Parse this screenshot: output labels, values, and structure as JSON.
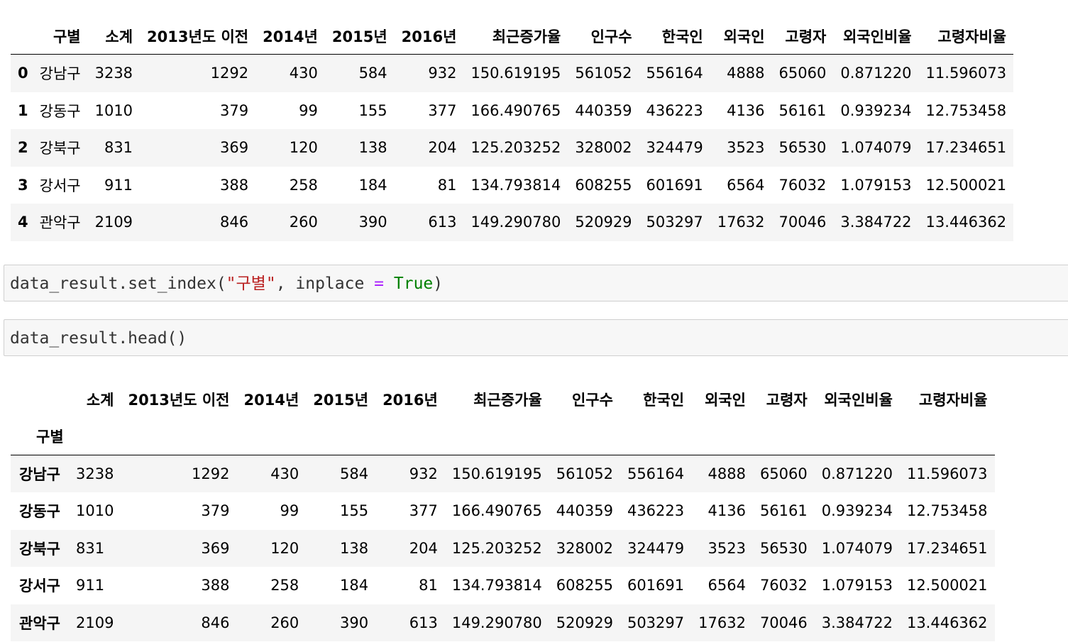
{
  "table1": {
    "headers": [
      "",
      "구별",
      "소계",
      "2013년도 이전",
      "2014년",
      "2015년",
      "2016년",
      "최근증가율",
      "인구수",
      "한국인",
      "외국인",
      "고령자",
      "외국인비율",
      "고령자비율"
    ],
    "rows": [
      [
        "0",
        "강남구",
        "3238",
        "1292",
        "430",
        "584",
        "932",
        "150.619195",
        "561052",
        "556164",
        "4888",
        "65060",
        "0.871220",
        "11.596073"
      ],
      [
        "1",
        "강동구",
        "1010",
        "379",
        "99",
        "155",
        "377",
        "166.490765",
        "440359",
        "436223",
        "4136",
        "56161",
        "0.939234",
        "12.753458"
      ],
      [
        "2",
        "강북구",
        "831",
        "369",
        "120",
        "138",
        "204",
        "125.203252",
        "328002",
        "324479",
        "3523",
        "56530",
        "1.074079",
        "17.234651"
      ],
      [
        "3",
        "강서구",
        "911",
        "388",
        "258",
        "184",
        "81",
        "134.793814",
        "608255",
        "601691",
        "6564",
        "76032",
        "1.079153",
        "12.500021"
      ],
      [
        "4",
        "관악구",
        "2109",
        "846",
        "260",
        "390",
        "613",
        "149.290780",
        "520929",
        "503297",
        "17632",
        "70046",
        "3.384722",
        "13.446362"
      ]
    ]
  },
  "code1": {
    "var": "data_result",
    "dot": ".",
    "method": "set_index",
    "open": "(",
    "arg_str": "\"구별\"",
    "comma": ", ",
    "kwarg": "inplace",
    "eq": " = ",
    "kw": "True",
    "close": ")"
  },
  "code2": {
    "text": "data_result.head()"
  },
  "table2": {
    "index_name": "구별",
    "headers": [
      "소계",
      "2013년도 이전",
      "2014년",
      "2015년",
      "2016년",
      "최근증가율",
      "인구수",
      "한국인",
      "외국인",
      "고령자",
      "외국인비율",
      "고령자비율"
    ],
    "rows": [
      [
        "강남구",
        "3238",
        "1292",
        "430",
        "584",
        "932",
        "150.619195",
        "561052",
        "556164",
        "4888",
        "65060",
        "0.871220",
        "11.596073"
      ],
      [
        "강동구",
        "1010",
        "379",
        "99",
        "155",
        "377",
        "166.490765",
        "440359",
        "436223",
        "4136",
        "56161",
        "0.939234",
        "12.753458"
      ],
      [
        "강북구",
        "831",
        "369",
        "120",
        "138",
        "204",
        "125.203252",
        "328002",
        "324479",
        "3523",
        "56530",
        "1.074079",
        "17.234651"
      ],
      [
        "강서구",
        "911",
        "388",
        "258",
        "184",
        "81",
        "134.793814",
        "608255",
        "601691",
        "6564",
        "76032",
        "1.079153",
        "12.500021"
      ],
      [
        "관악구",
        "2109",
        "846",
        "260",
        "390",
        "613",
        "149.290780",
        "520929",
        "503297",
        "17632",
        "70046",
        "3.384722",
        "13.446362"
      ]
    ]
  }
}
